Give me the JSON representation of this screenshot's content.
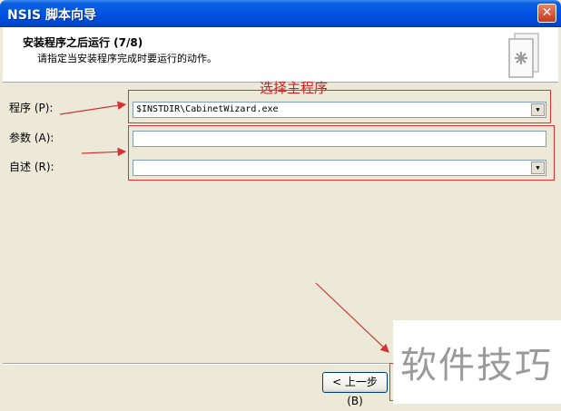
{
  "window": {
    "title": "NSIS 脚本向导",
    "close_glyph": "✕"
  },
  "header": {
    "title": "安装程序之后运行 (7/8)",
    "subtitle": "请指定当安装程序完成时要运行的动作。",
    "icon": "wizard-document-icon"
  },
  "annotation": {
    "text": "选择主程序",
    "color": "#C92121"
  },
  "form": {
    "program": {
      "label": "程序 (P):",
      "value": "$INSTDIR\\CabinetWizard.exe"
    },
    "params": {
      "label": "参数 (A):",
      "value": ""
    },
    "readme": {
      "label": "自述 (R):",
      "value": ""
    }
  },
  "buttons": {
    "back": "< 上一步 (B)"
  },
  "watermark": "软件技巧",
  "colors": {
    "titlebar": "#0054E3",
    "annotation_red": "#D33333",
    "dialog_bg": "#ECE9D8"
  }
}
